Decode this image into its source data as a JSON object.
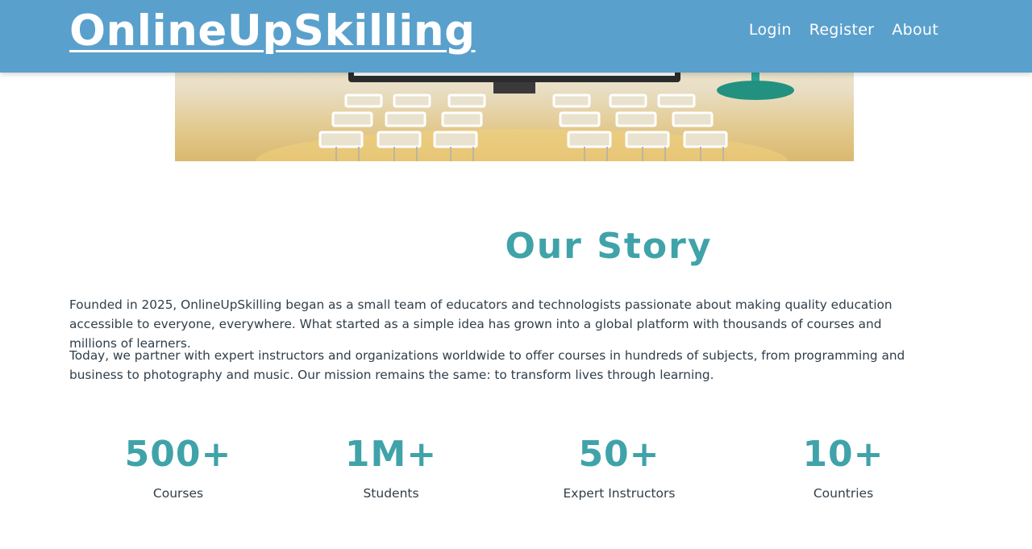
{
  "header": {
    "logo": "OnlineUpSkilling",
    "nav": [
      {
        "label": "Login"
      },
      {
        "label": "Register"
      },
      {
        "label": "About"
      }
    ]
  },
  "hero": {
    "image": "classroom-illustration"
  },
  "story": {
    "title": "Our Story",
    "paragraphs": [
      "Founded in 2025, OnlineUpSkilling began as a small team of educators and technologists passionate about making quality education accessible to everyone, everywhere. What started as a simple idea has grown into a global platform with thousands of courses and millions of learners.",
      "Today, we partner with expert instructors and organizations worldwide to offer courses in hundreds of subjects, from programming and business to photography and music. Our mission remains the same: to transform lives through learning."
    ]
  },
  "stats": [
    {
      "value": "500+",
      "label": "Courses"
    },
    {
      "value": "1M+",
      "label": "Students"
    },
    {
      "value": "50+",
      "label": "Expert Instructors"
    },
    {
      "value": "10+",
      "label": "Countries"
    }
  ],
  "colors": {
    "header_bg": "#5aa0cc",
    "accent": "#3fa3a9",
    "text": "#2f3e4a"
  }
}
